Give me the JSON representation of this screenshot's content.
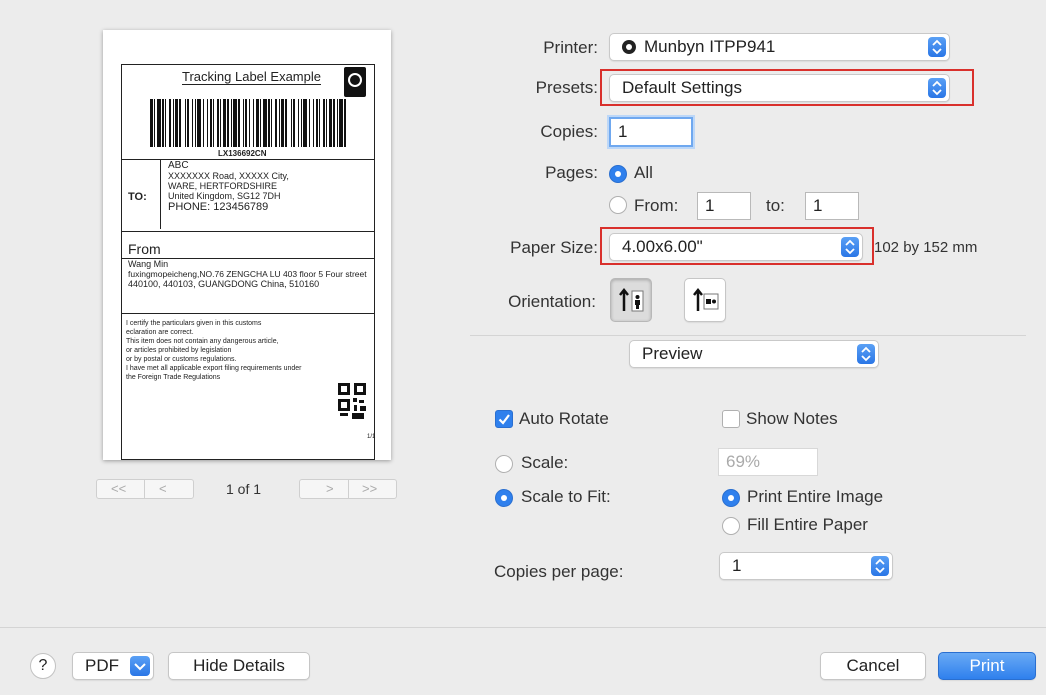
{
  "preview": {
    "label": {
      "title": "Tracking Label Example",
      "tracking_number": "LX136692CN",
      "to_label": "TO:",
      "to_lines": [
        "ABC",
        "XXXXXXX Road, XXXXX City,",
        "WARE, HERTFORDSHIRE",
        "United Kingdom, SG12 7DH",
        "PHONE: 123456789"
      ],
      "from_label": "From",
      "from_lines": [
        "Wang Min",
        "fuxingmopeicheng,NO.76 ZENGCHA LU 403 floor 5 Four street",
        "440100, 440103, GUANGDONG  China, 510160"
      ],
      "customs_lines": [
        "I certify the particulars given in this customs",
        "eclaration are correct.",
        "This item does not contain any dangerous article,",
        "or articles prohibited by legislation",
        "or by postal or customs regulations.",
        "I have met all applicable export filing requirements under",
        "the Foreign Trade Regulations"
      ],
      "page_mark": "1/1"
    },
    "nav": {
      "first": "<<",
      "prev": "<",
      "page_indicator": "1 of 1",
      "next": ">",
      "last": ">>"
    }
  },
  "printer": {
    "label": "Printer:",
    "value": "Munbyn ITPP941"
  },
  "presets": {
    "label": "Presets:",
    "value": "Default Settings"
  },
  "copies": {
    "label": "Copies:",
    "value": "1"
  },
  "pages": {
    "label": "Pages:",
    "all_label": "All",
    "from_label": "From:",
    "from_value": "1",
    "to_label": "to:",
    "to_value": "1",
    "selected": "All"
  },
  "paper_size": {
    "label": "Paper Size:",
    "value": "4.00x6.00\"",
    "dimensions": "102 by 152 mm"
  },
  "orientation": {
    "label": "Orientation:",
    "selected": "portrait"
  },
  "section_popup": {
    "value": "Preview"
  },
  "options": {
    "auto_rotate": {
      "label": "Auto Rotate",
      "checked": true
    },
    "show_notes": {
      "label": "Show Notes",
      "checked": false
    },
    "scale": {
      "label": "Scale:",
      "value": "69%"
    },
    "scale_to_fit": {
      "label": "Scale to Fit:",
      "selected": true
    },
    "print_entire_image": {
      "label": "Print Entire Image",
      "selected": true
    },
    "fill_entire_paper": {
      "label": "Fill Entire Paper",
      "selected": false
    },
    "copies_per_page": {
      "label": "Copies per page:",
      "value": "1"
    }
  },
  "footer": {
    "help": "?",
    "pdf": "PDF",
    "hide_details": "Hide Details",
    "cancel": "Cancel",
    "print": "Print"
  },
  "colors": {
    "accent": "#2f80ed",
    "highlight_box": "#d9302c"
  },
  "icons": [
    "printer-status-icon",
    "popup-arrows-icon",
    "portrait-icon",
    "landscape-icon",
    "checkmark-icon",
    "globe-logo-icon",
    "barcode-icon",
    "qr-code-icon"
  ]
}
